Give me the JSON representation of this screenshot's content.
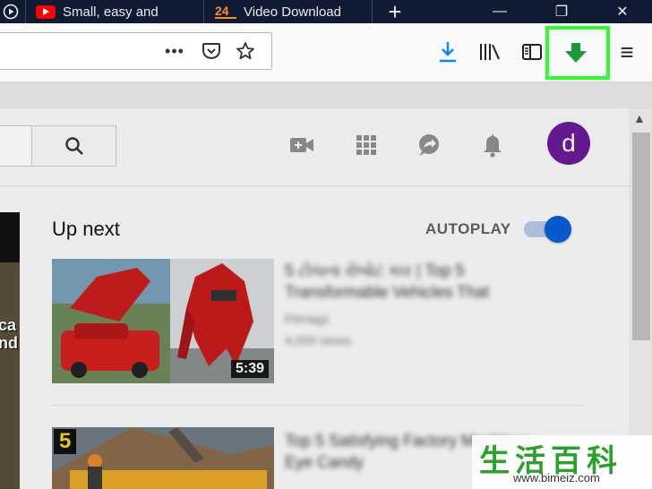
{
  "browser": {
    "tabs": [
      {
        "title": "Small, easy and"
      },
      {
        "title": "Video Download"
      }
    ],
    "window_controls": {
      "minimize": "—",
      "restore": "❐",
      "close": "✕"
    },
    "new_tab": "+",
    "nav": {
      "page_actions": "•••",
      "downloads": "downloads-icon",
      "library": "library-icon",
      "sidebar": "sidebar-icon",
      "extension_download": "green-download-arrow-icon",
      "menu": "≡"
    }
  },
  "youtube": {
    "avatar_letter": "d",
    "up_next": "Up next",
    "autoplay_label": "AUTOPLAY",
    "autoplay_on": true,
    "left_video_text": [
      "ca",
      "nd"
    ],
    "videos": [
      {
        "duration": "5:39",
        "title_blurred": "5 ટોચના રોબોટ કાર | Top 5 Transformable Vehicles That",
        "channel_blurred": "Fitmagz",
        "views_blurred": "4,000 views"
      },
      {
        "rank": "5",
        "title_blurred": "Top 5 Satisfying Factory Machines - Eye Candy",
        "channel_blurred": "",
        "views_blurred": ""
      }
    ]
  },
  "watermark": {
    "chars": "生活百科",
    "url": "www.bimeiz.com"
  },
  "colors": {
    "highlight": "#2dff2d",
    "download_blue": "#0a84ff",
    "extension_green": "#1c9a36",
    "autoplay_blue": "#065fd4",
    "avatar": "#6a1b9a"
  }
}
